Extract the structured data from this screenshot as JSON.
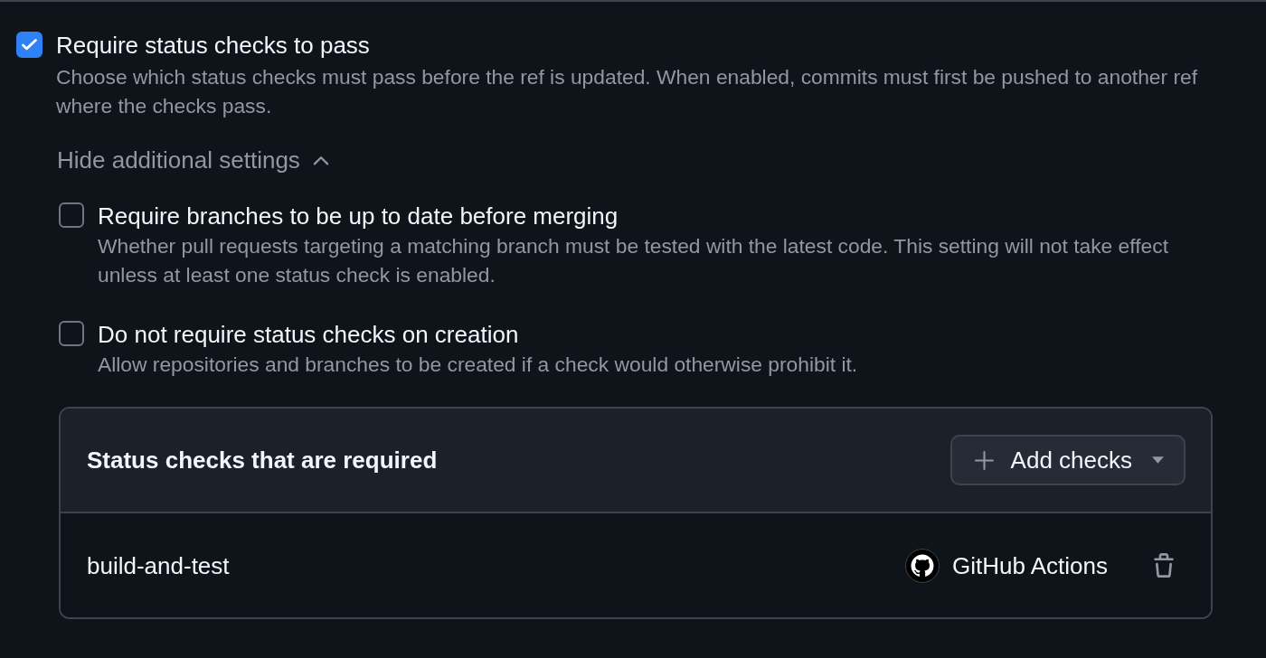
{
  "main_setting": {
    "label": "Require status checks to pass",
    "checked": true,
    "description": "Choose which status checks must pass before the ref is updated. When enabled, commits must first be pushed to another ref where the checks pass."
  },
  "toggle": {
    "label": "Hide additional settings",
    "expanded": true
  },
  "sub_settings": [
    {
      "label": "Require branches to be up to date before merging",
      "checked": false,
      "description": "Whether pull requests targeting a matching branch must be tested with the latest code. This setting will not take effect unless at least one status check is enabled."
    },
    {
      "label": "Do not require status checks on creation",
      "checked": false,
      "description": "Allow repositories and branches to be created if a check would otherwise prohibit it."
    }
  ],
  "required_checks": {
    "title": "Status checks that are required",
    "add_button": {
      "label": "Add checks"
    },
    "rows": [
      {
        "name": "build-and-test",
        "app": "GitHub Actions"
      }
    ]
  }
}
